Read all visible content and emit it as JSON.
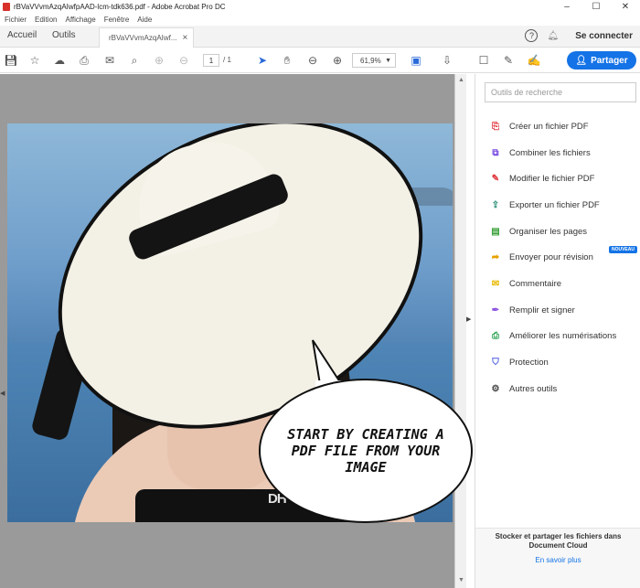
{
  "window": {
    "title": "rBVaVVvmAzqAIwfpAAD-lcm-tdk636.pdf - Adobe Acrobat Pro DC",
    "controls": [
      "–",
      "☐",
      "✕"
    ]
  },
  "menu": [
    "Fichier",
    "Edition",
    "Affichage",
    "Fenêtre",
    "Aide"
  ],
  "tabs": {
    "home": "Accueil",
    "tools": "Outils",
    "document": "rBVaVVvmAzqAIwf...",
    "close": "×",
    "help": "?",
    "sign_in": "Se connecter"
  },
  "toolbar": {
    "page_current": "1",
    "page_total": "/ 1",
    "zoom": "61,9%",
    "share": "Partager"
  },
  "speech_bubble": "START BY CREATING A PDF FILE FROM YOUR IMAGE",
  "watermark": "DH",
  "sidebar": {
    "search_placeholder": "Outils de recherche",
    "tools": [
      {
        "label": "Créer un fichier PDF",
        "color": "#e0383e",
        "icon": "create-pdf-icon"
      },
      {
        "label": "Combiner les fichiers",
        "color": "#7a4be0",
        "icon": "combine-files-icon"
      },
      {
        "label": "Modifier le fichier PDF",
        "color": "#e0383e",
        "icon": "edit-pdf-icon"
      },
      {
        "label": "Exporter un fichier PDF",
        "color": "#2d8f7a",
        "icon": "export-pdf-icon"
      },
      {
        "label": "Organiser les pages",
        "color": "#3aa03a",
        "icon": "organize-pages-icon"
      },
      {
        "label": "Envoyer pour révision",
        "color": "#e8a000",
        "icon": "send-review-icon",
        "badge": "NOUVEAU"
      },
      {
        "label": "Commentaire",
        "color": "#e8b800",
        "icon": "comment-icon"
      },
      {
        "label": "Remplir et signer",
        "color": "#8a4fe0",
        "icon": "fill-sign-icon"
      },
      {
        "label": "Améliorer les numérisations",
        "color": "#2aa050",
        "icon": "enhance-scans-icon"
      },
      {
        "label": "Protection",
        "color": "#4a5be0",
        "icon": "protect-icon"
      },
      {
        "label": "Autres outils",
        "color": "#444444",
        "icon": "more-tools-icon"
      }
    ],
    "promo_text": "Stocker et partager les fichiers dans Document Cloud",
    "promo_link": "En savoir plus"
  }
}
